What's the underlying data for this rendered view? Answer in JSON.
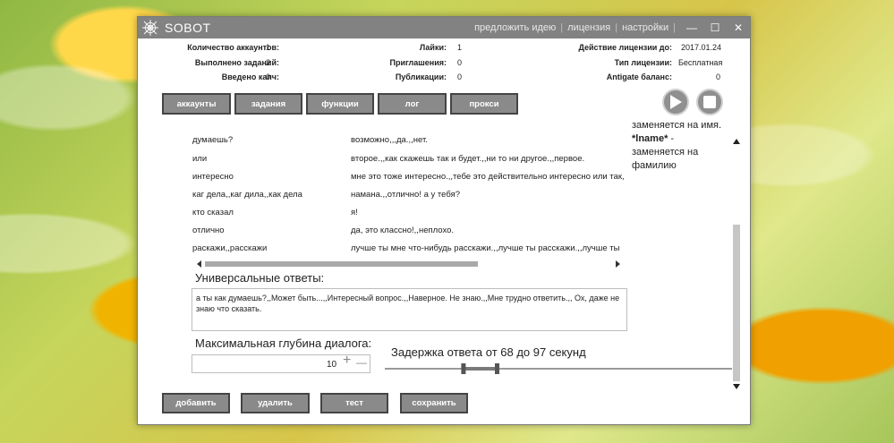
{
  "app": {
    "title": "SOBOT",
    "links": [
      "предложить идею",
      "лицензия",
      "настройки"
    ]
  },
  "stats": {
    "accounts_label": "Количество аккаунтов:",
    "accounts_value": "1",
    "tasks_label": "Выполнено заданий:",
    "tasks_value": "2",
    "captcha_label": "Введено капч:",
    "captcha_value": "0",
    "likes_label": "Лайки:",
    "likes_value": "1",
    "invites_label": "Приглашения:",
    "invites_value": "0",
    "posts_label": "Публикации:",
    "posts_value": "0",
    "license_until_label": "Действие лицензии до:",
    "license_until_value": "2017.01.24",
    "license_type_label": "Тип лицензии:",
    "license_type_value": "Бесплатная",
    "antigate_label": "Antigate баланс:",
    "antigate_value": "0"
  },
  "tabs": [
    "аккаунты",
    "задания",
    "функции",
    "лог",
    "прокси"
  ],
  "dialog_rows": [
    {
      "question": "думаешь?",
      "answer": "возможно,,,да.,,нет."
    },
    {
      "question": "или",
      "answer": "второе.,,как скажешь так и будет.,,ни то ни другое.,,первое."
    },
    {
      "question": "интересно",
      "answer": "мне это тоже интересно.,,тебе это действительно интересно или так,"
    },
    {
      "question": "каг дела,,каг дила,,как дела",
      "answer": "намана.,,отлично! а у тебя?"
    },
    {
      "question": "кто сказал",
      "answer": "я!"
    },
    {
      "question": "отлично",
      "answer": "да, это классно!,,неплохо."
    },
    {
      "question": "раскажи,,расскажи",
      "answer": "лучше ты мне что-нибудь расскажи.,,лучше ты расскажи.,,лучше ты"
    }
  ],
  "side_note": {
    "line1": "заменяется на имя.",
    "bold": "*lname*",
    "dash": " -",
    "line2": "заменяется на",
    "line3": "фамилию"
  },
  "universal": {
    "label": "Универсальные ответы:",
    "text": "а ты как думаешь?,,Может быть...,,Интересный вопрос.,,Наверное. Не знаю.,,Мне трудно ответить.,, Ох, даже не знаю что сказать."
  },
  "depth": {
    "label": "Максимальная глубина диалога:",
    "value": "10",
    "plus": "+",
    "minus": "—"
  },
  "delay": {
    "label": "Задержка ответа от 68 до 97 секунд",
    "min": 68,
    "max": 97
  },
  "buttons": {
    "add": "добавить",
    "delete": "удалить",
    "test": "тест",
    "save": "сохранить"
  }
}
